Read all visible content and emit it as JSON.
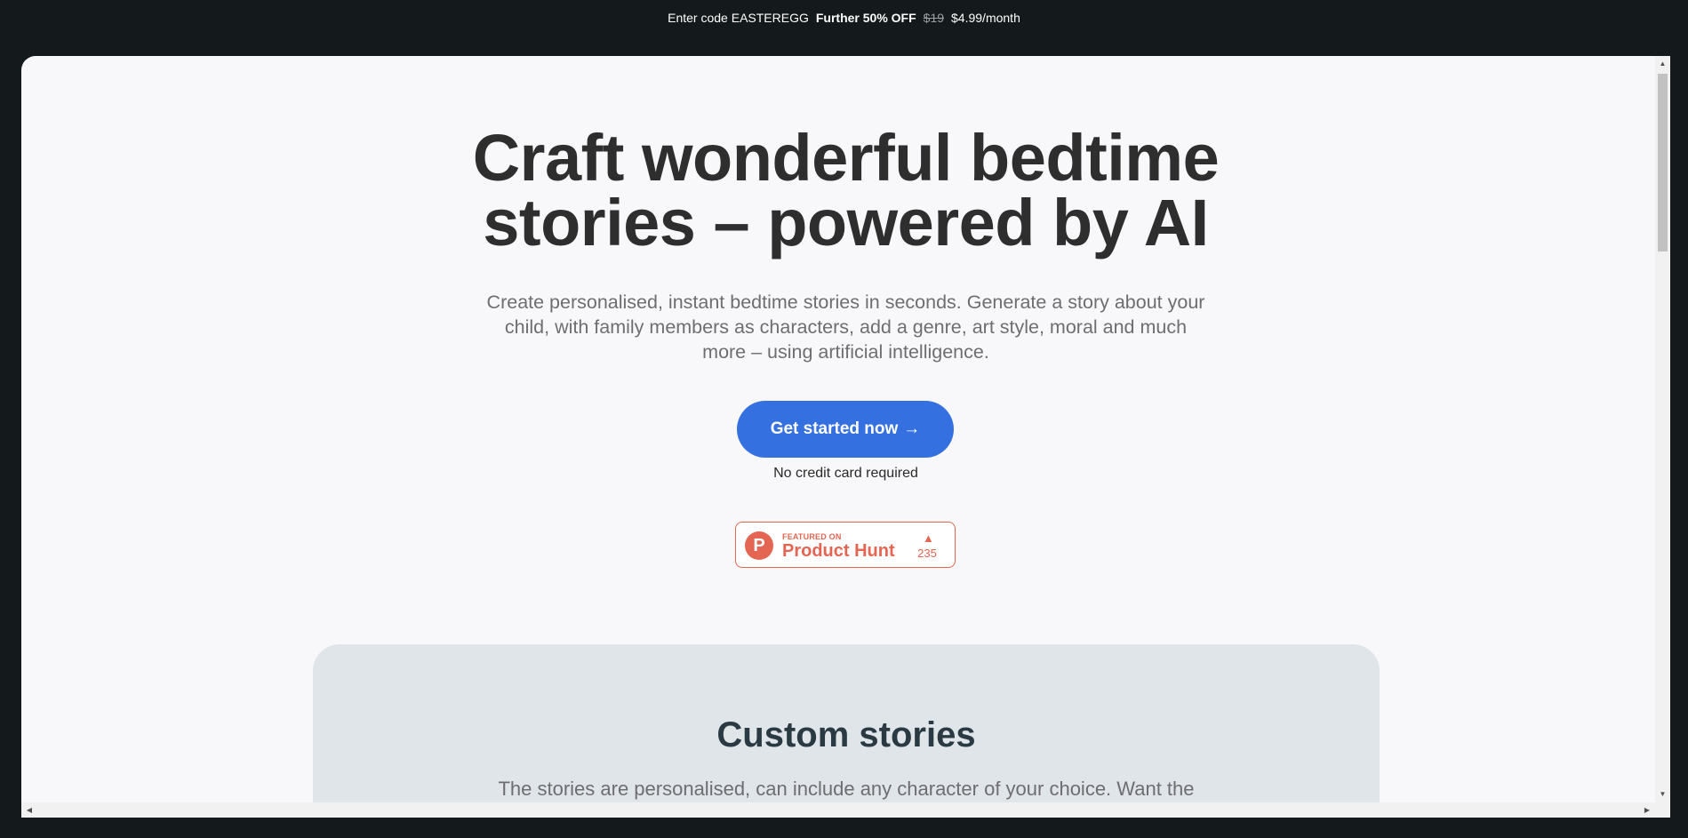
{
  "promo": {
    "prefix": "Enter code EASTEREGG",
    "highlight": "Further 50% OFF",
    "old_price": "$19",
    "new_price": "$4.99/month"
  },
  "hero": {
    "title_line1": "Craft wonderful bedtime",
    "title_line2": "stories – powered by AI",
    "subtitle": "Create personalised, instant bedtime stories in seconds. Generate a story about your child, with family members as characters, add a genre, art style, moral and much more – using artificial intelligence.",
    "cta_label": "Get started now",
    "cta_arrow": "→",
    "cta_note": "No credit card required"
  },
  "product_hunt": {
    "featured_label": "FEATURED ON",
    "name": "Product Hunt",
    "logo_letter": "P",
    "arrow": "▲",
    "votes": "235"
  },
  "feature": {
    "title": "Custom stories",
    "text": "The stories are personalised, can include any character of your choice. Want the"
  },
  "colors": {
    "accent": "#3570e0",
    "product_hunt": "#e46552",
    "page_bg": "#f8f8fa",
    "frame_bg": "#141a1b",
    "card_bg": "#dfe5e8"
  }
}
